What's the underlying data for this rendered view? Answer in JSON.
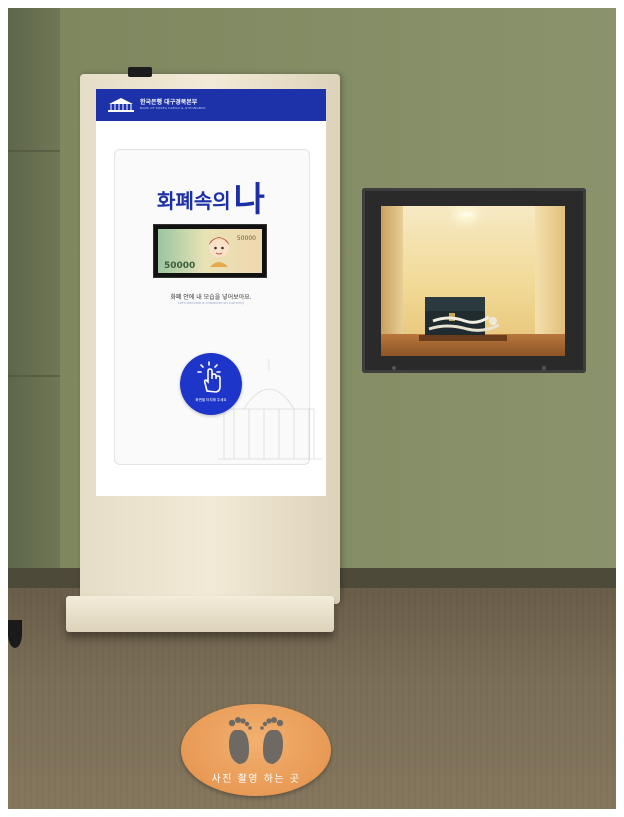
{
  "kiosk_screen": {
    "header_title": "한국은행 대구경북본부",
    "header_subtitle": "BANK OF KOREA DAEGU & GYEONGBUK",
    "title_part1": "화폐속의",
    "title_part2": "나",
    "banknote_value": "50000",
    "message_ko": "화폐 안에 내 모습을 넣어보아요.",
    "message_en": "Let's become a character on currency",
    "touch_button_label": "화면을 터치해 주세요",
    "accent_color": "#1d31a8"
  },
  "floor_marker": {
    "text": "사진 촬영 하는 곳",
    "color": "#e89a55"
  }
}
